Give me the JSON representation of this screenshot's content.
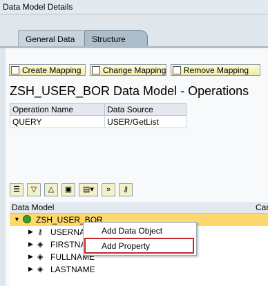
{
  "window": {
    "title": "Data Model Details"
  },
  "tabs": [
    {
      "label": "General Data"
    },
    {
      "label": "Structure"
    }
  ],
  "buttons": {
    "create": "Create Mapping",
    "change": "Change Mapping",
    "remove": "Remove Mapping"
  },
  "heading": "ZSH_USER_BOR Data Model - Operations",
  "operations_table": {
    "headers": [
      "Operation Name",
      "Data Source"
    ],
    "rows": [
      [
        "QUERY",
        "USER/GetList"
      ]
    ]
  },
  "tree": {
    "headers": {
      "model": "Data Model",
      "card": "Card"
    },
    "root": "ZSH_USER_BOR",
    "children": [
      "USERNA",
      "FIRSTNA",
      "FULLNAME",
      "LASTNAME"
    ]
  },
  "context_menu": {
    "items": [
      "Add Data Object",
      "Add Property"
    ]
  },
  "colors": {
    "highlight_row": "#fcd86e",
    "annotation_box": "#c0262c"
  }
}
